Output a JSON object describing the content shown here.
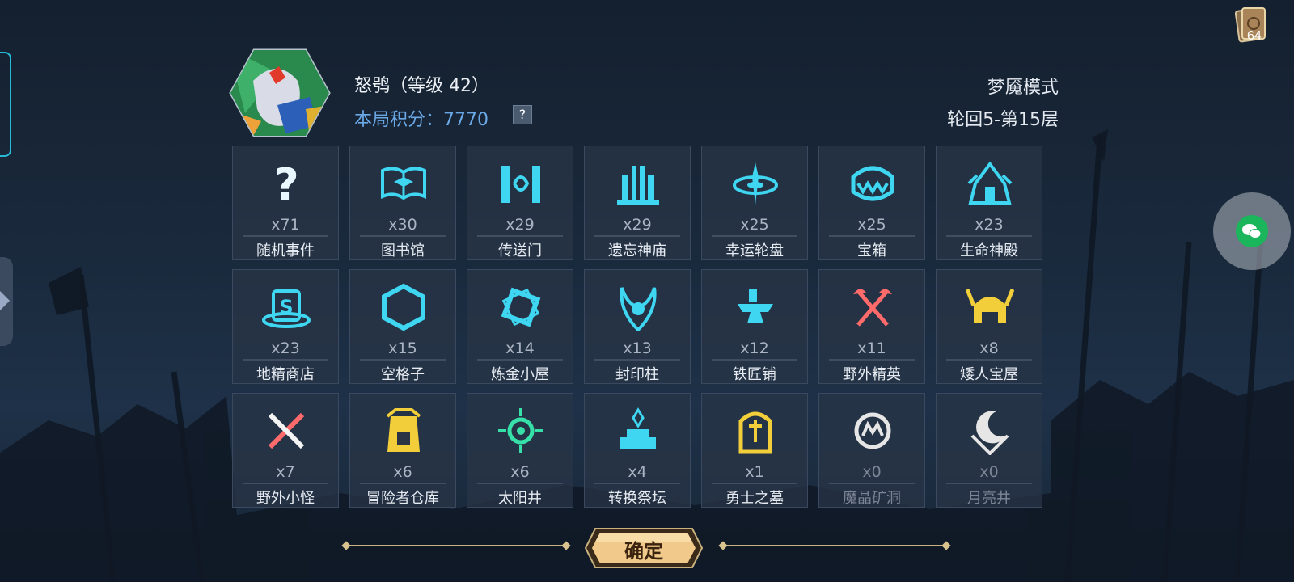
{
  "deck": {
    "icon": "card-deck-icon",
    "count": "64"
  },
  "player": {
    "name": "怒鸮（等级 42）",
    "score_label": "本局积分：7770",
    "help_glyph": "?",
    "avatar_icon": "owl-portrait-icon"
  },
  "mode": {
    "title": "梦魇模式",
    "round": "轮回5-第15层"
  },
  "tiles": [
    {
      "label": "随机事件",
      "count": "x71",
      "icon": "question-icon",
      "color": "#e9f7ff",
      "dim": false
    },
    {
      "label": "图书馆",
      "count": "x30",
      "icon": "library-book-icon",
      "color": "#3fd6f2",
      "dim": false
    },
    {
      "label": "传送门",
      "count": "x29",
      "icon": "portal-icon",
      "color": "#3fd6f2",
      "dim": false
    },
    {
      "label": "遗忘神庙",
      "count": "x29",
      "icon": "temple-icon",
      "color": "#3fd6f2",
      "dim": false
    },
    {
      "label": "幸运轮盘",
      "count": "x25",
      "icon": "lucky-wheel-icon",
      "color": "#3fd6f2",
      "dim": false
    },
    {
      "label": "宝箱",
      "count": "x25",
      "icon": "treasure-chest-icon",
      "color": "#3fd6f2",
      "dim": false
    },
    {
      "label": "生命神殿",
      "count": "x23",
      "icon": "life-shrine-icon",
      "color": "#3fd6f2",
      "dim": false
    },
    {
      "label": "地精商店",
      "count": "x23",
      "icon": "goblin-shop-icon",
      "color": "#3fd6f2",
      "dim": false
    },
    {
      "label": "空格子",
      "count": "x15",
      "icon": "empty-hexagon-icon",
      "color": "#3fd6f2",
      "dim": false
    },
    {
      "label": "炼金小屋",
      "count": "x14",
      "icon": "alchemy-hut-icon",
      "color": "#3fd6f2",
      "dim": false
    },
    {
      "label": "封印柱",
      "count": "x13",
      "icon": "seal-pillar-icon",
      "color": "#3fd6f2",
      "dim": false
    },
    {
      "label": "铁匠铺",
      "count": "x12",
      "icon": "anvil-icon",
      "color": "#3fd6f2",
      "dim": false
    },
    {
      "label": "野外精英",
      "count": "x11",
      "icon": "crossed-axes-icon",
      "color": "#ff6a6a",
      "dim": false
    },
    {
      "label": "矮人宝屋",
      "count": "x8",
      "icon": "dwarf-helmet-icon",
      "color": "#f2cf3a",
      "dim": false
    },
    {
      "label": "野外小怪",
      "count": "x7",
      "icon": "crossed-swords-icon",
      "color": "#ff6a6a",
      "dim": false
    },
    {
      "label": "冒险者仓库",
      "count": "x6",
      "icon": "warehouse-icon",
      "color": "#f2cf3a",
      "dim": false
    },
    {
      "label": "太阳井",
      "count": "x6",
      "icon": "sun-well-icon",
      "color": "#36e0a8",
      "dim": false
    },
    {
      "label": "转换祭坛",
      "count": "x4",
      "icon": "altar-icon",
      "color": "#3fd6f2",
      "dim": false
    },
    {
      "label": "勇士之墓",
      "count": "x1",
      "icon": "tomb-icon",
      "color": "#f2cf3a",
      "dim": false
    },
    {
      "label": "魔晶矿洞",
      "count": "x0",
      "icon": "crystal-mine-icon",
      "color": "#e6e6e6",
      "dim": true
    },
    {
      "label": "月亮井",
      "count": "x0",
      "icon": "moon-well-icon",
      "color": "#e6e6e6",
      "dim": true
    }
  ],
  "confirm": {
    "label": "确定"
  }
}
